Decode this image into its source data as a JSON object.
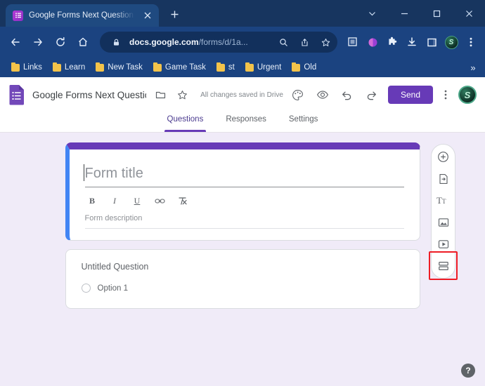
{
  "browser": {
    "tab": {
      "title": "Google Forms Next Question Bas",
      "favicon_icon": "forms-favicon-icon",
      "close_icon": "close-icon"
    },
    "new_tab_label": "+",
    "window_controls": [
      {
        "name": "tab-search",
        "glyph": "chevron-down-icon"
      },
      {
        "name": "minimize",
        "glyph": "minimize-icon"
      },
      {
        "name": "maximize",
        "glyph": "maximize-icon"
      },
      {
        "name": "close",
        "glyph": "close-window-icon"
      }
    ],
    "nav": {
      "back_icon": "back-arrow-icon",
      "forward_icon": "forward-arrow-icon",
      "reload_icon": "reload-icon",
      "home_icon": "home-icon"
    },
    "omnibox": {
      "lock_icon": "lock-icon",
      "url_domain": "docs.google.com",
      "url_path": "/forms/d/1a...",
      "search_icon": "search-icon",
      "share_icon": "share-icon",
      "bookmark_icon": "star-icon"
    },
    "extensions": [
      {
        "name": "qr-code-extension-icon"
      },
      {
        "name": "purple-circle-extension-icon"
      },
      {
        "name": "extensions-puzzle-icon"
      },
      {
        "name": "downloads-icon"
      },
      {
        "name": "side-panel-icon"
      },
      {
        "name": "profile-avatar-icon"
      },
      {
        "name": "chrome-menu-icon"
      }
    ],
    "bookmarks": [
      {
        "label": "Links"
      },
      {
        "label": "Learn"
      },
      {
        "label": "New Task"
      },
      {
        "label": "Game Task"
      },
      {
        "label": "st"
      },
      {
        "label": "Urgent"
      },
      {
        "label": "Old"
      }
    ],
    "bookmarks_overflow": "»"
  },
  "forms": {
    "logo_icon": "google-forms-logo-icon",
    "doc_title": "Google Forms Next Question Based or",
    "move_folder_icon": "folder-icon",
    "star_icon": "star-outline-icon",
    "save_status": "All changes saved in Drive",
    "actions": [
      {
        "name": "theme-button",
        "icon": "palette-icon"
      },
      {
        "name": "preview-button",
        "icon": "eye-icon"
      },
      {
        "name": "undo-button",
        "icon": "undo-icon"
      },
      {
        "name": "redo-button",
        "icon": "redo-icon"
      }
    ],
    "send_label": "Send",
    "more_icon": "more-vertical-icon",
    "avatar_letter": "S",
    "tabs": [
      {
        "label": "Questions",
        "active": true
      },
      {
        "label": "Responses",
        "active": false
      },
      {
        "label": "Settings",
        "active": false
      }
    ],
    "title_card": {
      "title_placeholder": "Form title",
      "description_placeholder": "Form description",
      "format_buttons": [
        {
          "name": "bold-button",
          "glyph": "B"
        },
        {
          "name": "italic-button",
          "glyph": "I"
        },
        {
          "name": "underline-button",
          "glyph": "U"
        },
        {
          "name": "link-button",
          "glyph": "link-icon"
        },
        {
          "name": "clear-formatting-button",
          "glyph": "clear-format-icon"
        }
      ]
    },
    "question_card": {
      "question_title": "Untitled Question",
      "option_label": "Option 1"
    },
    "side_toolbar": [
      {
        "name": "add-question-button",
        "icon": "plus-circle-icon",
        "highlighted": false
      },
      {
        "name": "import-questions-button",
        "icon": "import-icon",
        "highlighted": false
      },
      {
        "name": "add-title-description-button",
        "icon": "text-title-icon",
        "highlighted": false
      },
      {
        "name": "add-image-button",
        "icon": "image-icon",
        "highlighted": false
      },
      {
        "name": "add-video-button",
        "icon": "video-icon",
        "highlighted": false
      },
      {
        "name": "add-section-button",
        "icon": "add-section-icon",
        "highlighted": true
      }
    ],
    "help_label": "?",
    "colors": {
      "accent_purple": "#673ab7",
      "canvas_bg": "#f0ebf8",
      "card_left_accent": "#4285f4",
      "highlight_red": "#ee1c25"
    }
  }
}
